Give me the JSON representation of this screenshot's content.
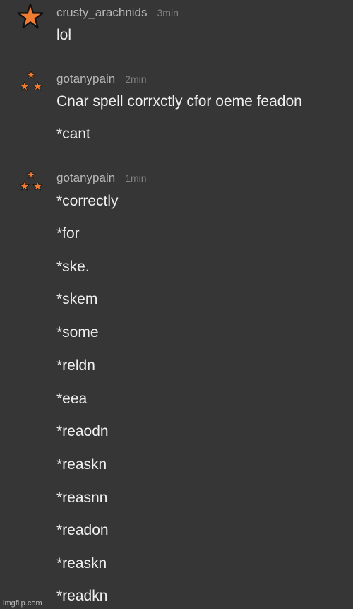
{
  "messages": [
    {
      "username": "crusty_arachnids",
      "time": "3min",
      "avatar_icon": "orange-star-icon",
      "lines": [
        "lol"
      ]
    },
    {
      "username": "gotanypain",
      "time": "2min",
      "avatar_icon": "triple-star-icon",
      "lines": [
        "Cnar spell corrxctly cfor oeme feadon",
        "*cant"
      ]
    },
    {
      "username": "gotanypain",
      "time": "1min",
      "avatar_icon": "triple-star-icon",
      "lines": [
        "*correctly",
        "*for",
        "*ske.",
        "*skem",
        "*some",
        "*reldn",
        "*eea",
        "*reaodn",
        "*reaskn",
        "*reasnn",
        "*readon",
        "*reaskn",
        "*readkn"
      ]
    }
  ],
  "colors": {
    "background": "#363636",
    "star_fill": "#f07c32",
    "star_outline": "#111111"
  },
  "watermark": "imgflip.com"
}
